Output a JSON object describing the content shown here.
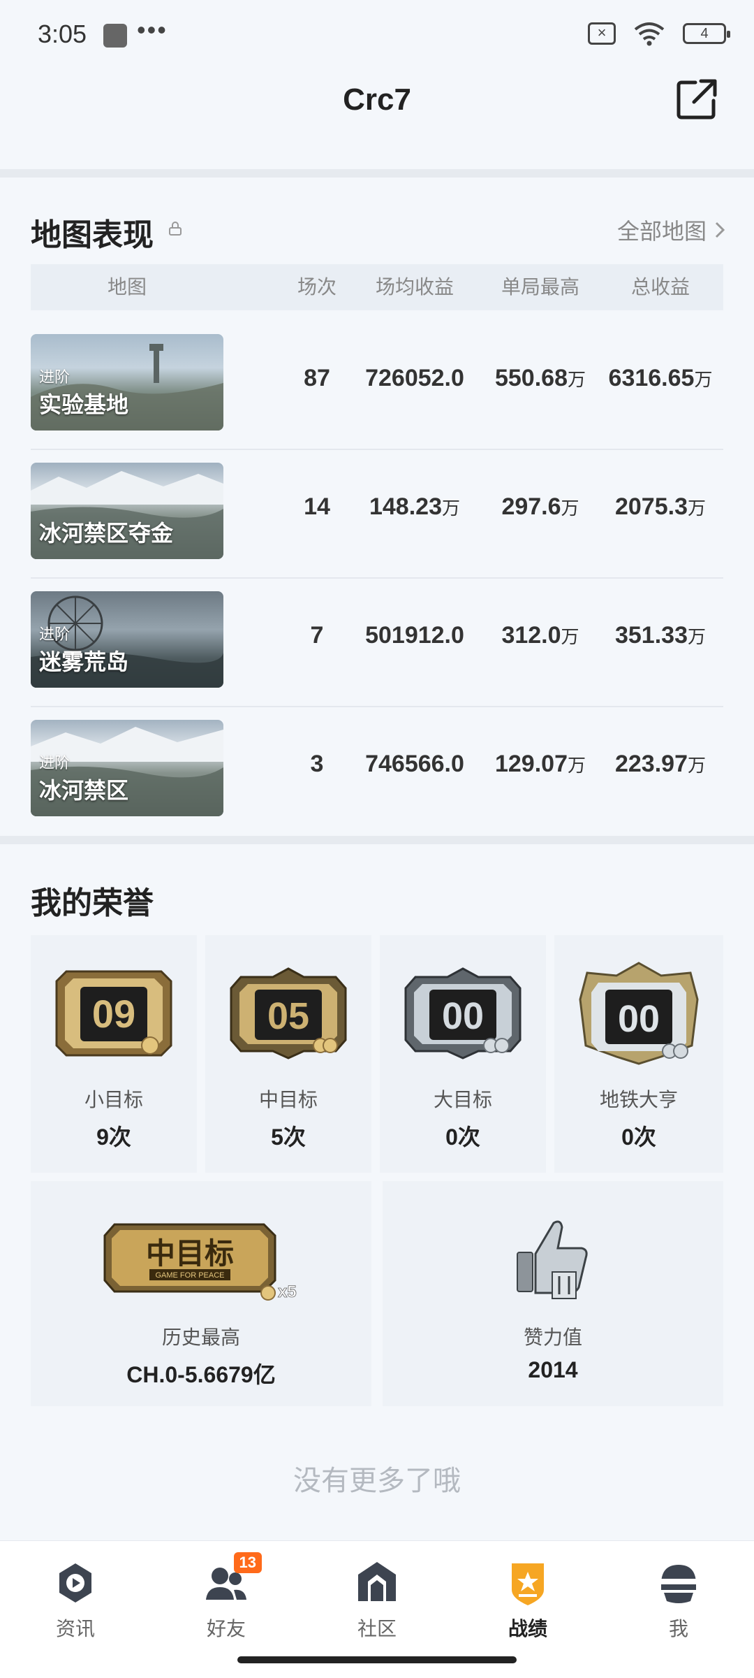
{
  "status_bar": {
    "time": "3:05",
    "dots": "•••",
    "sim_mark": "×",
    "battery": "4"
  },
  "header": {
    "title": "Crc7"
  },
  "map_section": {
    "title": "地图表现",
    "all_maps_label": "全部地图",
    "columns": [
      "地图",
      "场次",
      "场均收益",
      "单局最高",
      "总收益"
    ],
    "rows": [
      {
        "subtitle": "进阶",
        "name": "实验基地",
        "matches": "87",
        "avg": "726052.0",
        "avg_unit": "",
        "best": "550.68",
        "best_unit": "万",
        "total": "6316.65",
        "total_unit": "万"
      },
      {
        "subtitle": "",
        "name": "冰河禁区夺金",
        "matches": "14",
        "avg": "148.23",
        "avg_unit": "万",
        "best": "297.6",
        "best_unit": "万",
        "total": "2075.3",
        "total_unit": "万"
      },
      {
        "subtitle": "进阶",
        "name": "迷雾荒岛",
        "matches": "7",
        "avg": "501912.0",
        "avg_unit": "",
        "best": "312.0",
        "best_unit": "万",
        "total": "351.33",
        "total_unit": "万"
      },
      {
        "subtitle": "进阶",
        "name": "冰河禁区",
        "matches": "3",
        "avg": "746566.0",
        "avg_unit": "",
        "best": "129.07",
        "best_unit": "万",
        "total": "223.97",
        "total_unit": "万"
      }
    ]
  },
  "honor_section": {
    "title": "我的荣誉",
    "badges": [
      {
        "number": "09",
        "label": "小目标",
        "value": "9次",
        "icon": "small-target-badge-icon"
      },
      {
        "number": "05",
        "label": "中目标",
        "value": "5次",
        "icon": "medium-target-badge-icon"
      },
      {
        "number": "00",
        "label": "大目标",
        "value": "0次",
        "icon": "big-target-badge-icon"
      },
      {
        "number": "00",
        "label": "地铁大亨",
        "value": "0次",
        "icon": "metro-tycoon-badge-icon"
      }
    ],
    "history": {
      "badge_text": "中目标",
      "badge_sub": "GAME FOR PEACE",
      "badge_mult": "x5",
      "label": "历史最高",
      "value": "CH.0-5.6679亿"
    },
    "likes": {
      "label": "赞力值",
      "value": "2014",
      "icon": "thumbs-up-icon"
    }
  },
  "footer_note": "没有更多了哦",
  "bottom_nav": {
    "items": [
      {
        "label": "资讯",
        "icon": "news-icon"
      },
      {
        "label": "好友",
        "icon": "friends-icon",
        "badge": "13"
      },
      {
        "label": "社区",
        "icon": "community-icon"
      },
      {
        "label": "战绩",
        "icon": "record-icon",
        "active": true
      },
      {
        "label": "我",
        "icon": "profile-icon"
      }
    ]
  },
  "colors": {
    "accent": "#f6a623",
    "badge": "#ff6a1a",
    "gold": "#c9a55a",
    "silver": "#b8c0c8"
  }
}
